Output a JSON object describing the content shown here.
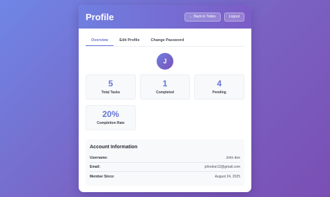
{
  "header": {
    "title": "Profile",
    "back_label": "← Back to Todos",
    "logout_label": "Logout"
  },
  "tabs": [
    {
      "label": "Overview",
      "active": true
    },
    {
      "label": "Edit Profile",
      "active": false
    },
    {
      "label": "Change Password",
      "active": false
    }
  ],
  "avatar": {
    "initial": "J"
  },
  "stats": [
    {
      "value": "5",
      "label": "Total Tasks"
    },
    {
      "value": "1",
      "label": "Completed"
    },
    {
      "value": "4",
      "label": "Pending"
    },
    {
      "value": "20%",
      "label": "Completion Rate"
    }
  ],
  "account": {
    "title": "Account Information",
    "rows": [
      {
        "key": "Username:",
        "value": "John doe"
      },
      {
        "key": "Email:",
        "value": "johndoe12@gmail.com"
      },
      {
        "key": "Member Since:",
        "value": "August 24, 2025"
      }
    ]
  },
  "colors": {
    "accent": "#6874d8",
    "header_start": "#6f7fe0",
    "header_end": "#7c5cc6"
  }
}
